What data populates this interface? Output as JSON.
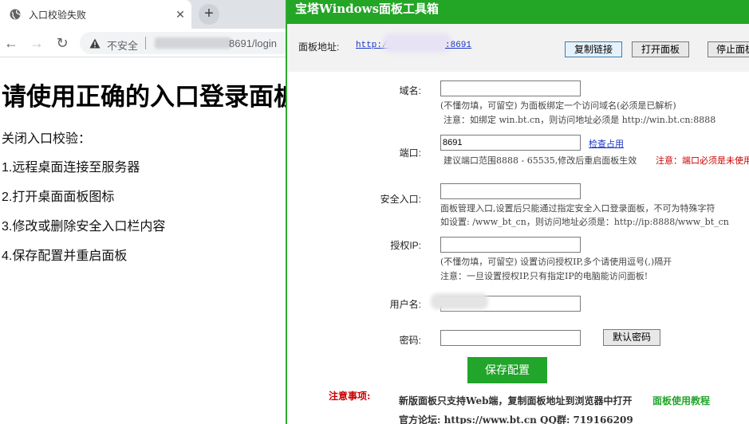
{
  "browser": {
    "tab_title": "入口校验失败",
    "tab_close": "✕",
    "new_tab": "+",
    "back": "←",
    "forward": "→",
    "reload": "↻",
    "insecure_label": "不安全",
    "url_visible": "8691/login",
    "icons": {
      "favicon": "globe-icon",
      "warning": "warning-triangle-icon"
    }
  },
  "page": {
    "heading": "请使用正确的入口登录面板",
    "intro": "关闭入口校验：",
    "steps": [
      "1.远程桌面连接至服务器",
      "2.打开桌面面板图标",
      "3.修改或删除安全入口栏内容",
      "4.保存配置并重启面板"
    ]
  },
  "tool": {
    "title": "宝塔Windows面板工具箱",
    "accent_color": "#23a525",
    "panel_address_label": "面板地址:",
    "panel_url_start": "http://",
    "panel_url_end": ":8691",
    "copy_link": "复制链接",
    "open_panel": "打开面板",
    "stop_panel": "停止面板",
    "domain": {
      "label": "域名:",
      "value": "",
      "hint1": "(不懂勿填，可留空) 为面板绑定一个访问域名(必须是已解析)",
      "hint2": "注意：如绑定 win.bt.cn，则访问地址必须是 http://win.bt.cn:8888"
    },
    "port": {
      "label": "端口:",
      "value": "8691",
      "check_link": "检查占用",
      "hint": "建议端口范围8888 - 65535,修改后重启面板生效",
      "warning": "注意：端口必须是未使用"
    },
    "entrance": {
      "label": "安全入口:",
      "value": "",
      "hint1": "面板管理入口,设置后只能通过指定安全入口登录面板，不可为特殊字符",
      "hint2": "如设置: /www_bt_cn，则访问地址必须是：http://ip:8888/www_bt_cn"
    },
    "auth_ip": {
      "label": "授权IP:",
      "value": "",
      "hint1": "(不懂勿填，可留空) 设置访问授权IP,多个请使用逗号(,)隔开",
      "hint2": "注意：一旦设置授权IP,只有指定IP的电脑能访问面板!"
    },
    "username": {
      "label": "用户名:",
      "value": ""
    },
    "password": {
      "label": "密码:",
      "value": "",
      "default_btn": "默认密码"
    },
    "save": "保存配置",
    "notice_label": "注意事项:",
    "notice_text": "新版面板只支持Web端，复制面板地址到浏览器中打开",
    "tutorial_link": "面板使用教程",
    "forum": "官方论坛: https://www.bt.cn  QQ群: 719166209"
  }
}
